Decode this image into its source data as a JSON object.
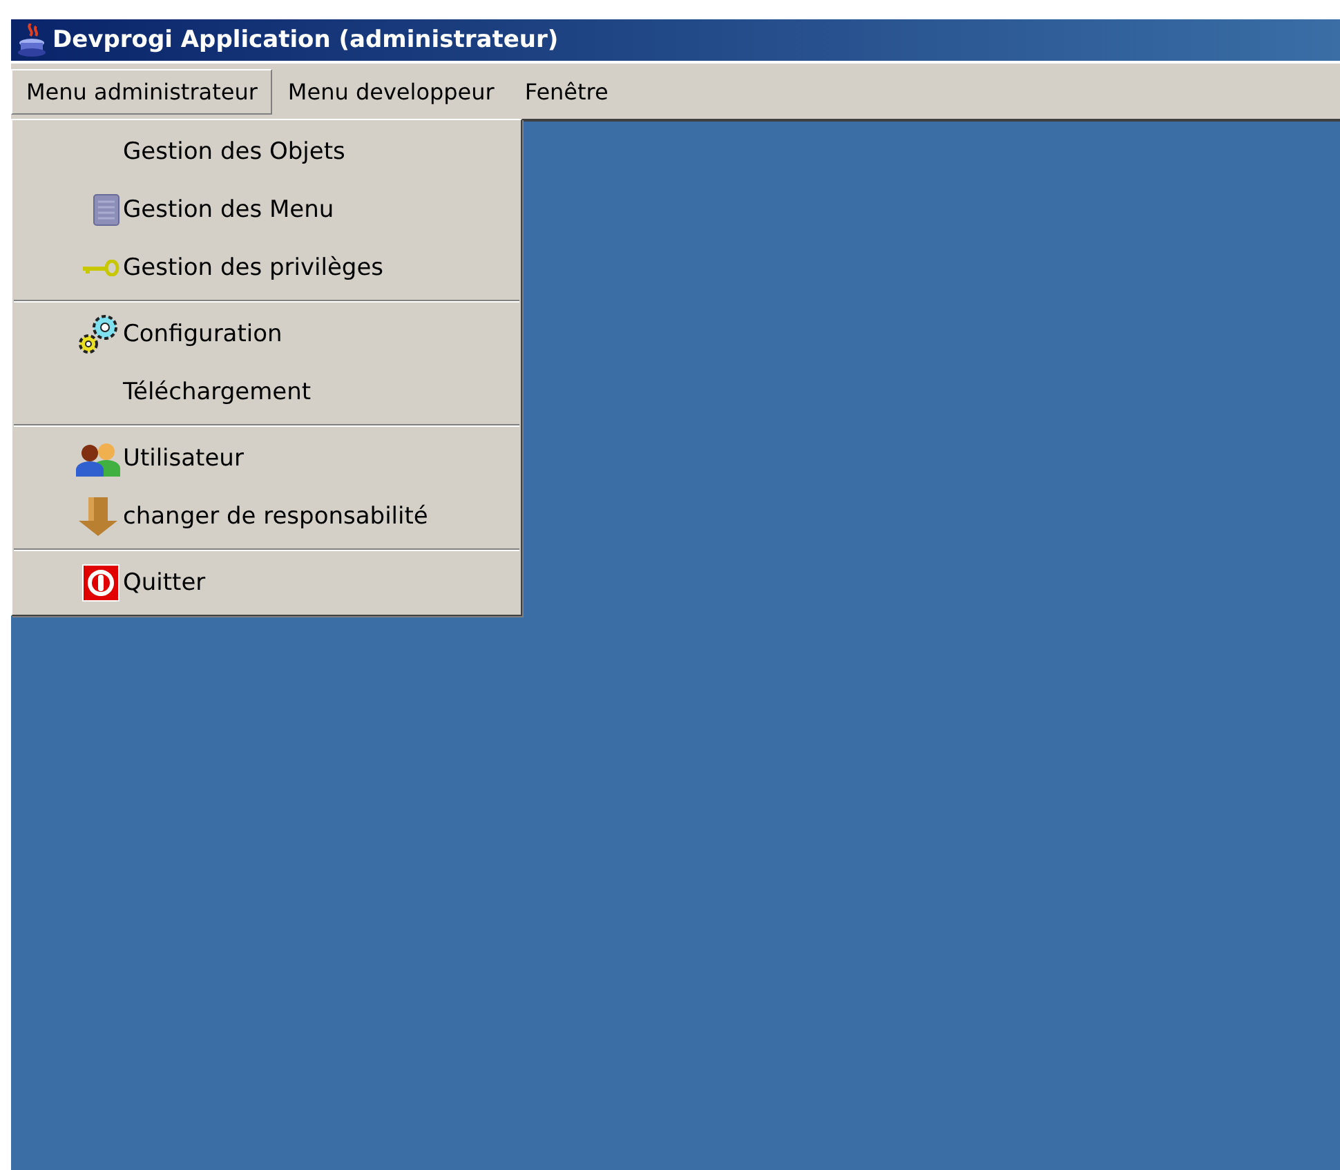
{
  "window": {
    "title": "Devprogi Application (administrateur)"
  },
  "menu_bar": [
    {
      "label": "Menu administrateur",
      "selected": true
    },
    {
      "label": "Menu developpeur",
      "selected": false
    },
    {
      "label": "Fenêtre",
      "selected": false
    }
  ],
  "dropdown": {
    "groups": [
      [
        {
          "label": "Gestion des Objets",
          "kind": "plain"
        },
        {
          "label": "Gestion des Menu",
          "kind": "document"
        },
        {
          "label": "Gestion des privilèges",
          "kind": "key"
        }
      ],
      [
        {
          "label": "Configuration",
          "kind": "gears"
        },
        {
          "label": "Téléchargement",
          "kind": "plain"
        }
      ],
      [
        {
          "label": "Utilisateur",
          "kind": "users"
        },
        {
          "label": "changer de responsabilité",
          "kind": "arrow"
        }
      ],
      [
        {
          "label": "Quitter",
          "kind": "power"
        }
      ]
    ]
  }
}
